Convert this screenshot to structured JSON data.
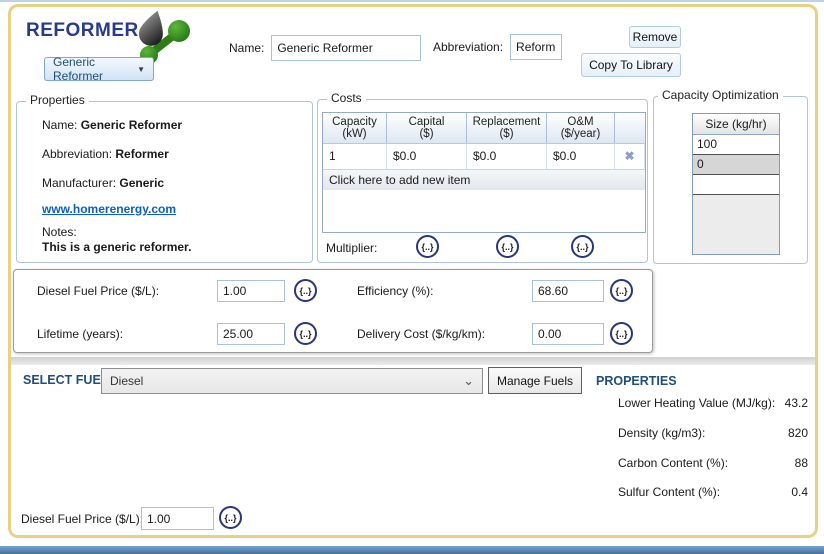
{
  "colors": {
    "title_blue": "#273b8e",
    "accent_blue": "#1f4e79",
    "gold_border": "#e8d185",
    "bottom_bar_blue": "#44719f",
    "link_blue": "#0b5fc0",
    "icon_green": "#2f7d17"
  },
  "icons": {
    "reformer": "oil-drop-and-molecule",
    "selector_arrow": "▼",
    "delete": "✖",
    "fuel_dropdown_chevron": "⌄"
  },
  "header": {
    "title": "REFORMER",
    "selector_value": "Generic Reformer",
    "name_label": "Name:",
    "name_value": "Generic Reformer",
    "abbreviation_label": "Abbreviation:",
    "abbreviation_value": "Reformer",
    "remove_button": "Remove",
    "copy_button": "Copy To Library"
  },
  "properties_box": {
    "title": "Properties",
    "rows": [
      {
        "label": "Name:",
        "value": "Generic Reformer"
      },
      {
        "label": "Abbreviation:",
        "value": "Reformer"
      },
      {
        "label": "Manufacturer:",
        "value": "Generic"
      }
    ],
    "link": "www.homerenergy.com",
    "notes_label": "Notes:",
    "notes_value": "This is a generic reformer."
  },
  "costs_box": {
    "title": "Costs",
    "table": {
      "headers": [
        {
          "line1": "Capacity",
          "line2": "(kW)"
        },
        {
          "line1": "Capital",
          "line2": "($)"
        },
        {
          "line1": "Replacement",
          "line2": "($)"
        },
        {
          "line1": "O&M",
          "line2": "($/year)"
        }
      ],
      "rows": [
        [
          "1",
          "$0.0",
          "$0.0",
          "$0.0"
        ]
      ],
      "add_row_text": "Click here to add new item"
    },
    "multiplier_label": "Multiplier:",
    "dots_glyph": "{..}"
  },
  "capacity_box": {
    "title": "Capacity Optimization",
    "header": "Size (kg/hr)",
    "rows": [
      "100",
      "0",
      ""
    ]
  },
  "params_box": {
    "left": [
      {
        "label": "Diesel Fuel Price ($/L):",
        "value": "1.00"
      },
      {
        "label": "Lifetime (years):",
        "value": "25.00"
      }
    ],
    "right": [
      {
        "label": "Efficiency (%):",
        "value": "68.60"
      },
      {
        "label": "Delivery Cost ($/kg/km):",
        "value": "0.00"
      }
    ],
    "dots_glyph": "{..}"
  },
  "fuel_section": {
    "select_label": "SELECT FUEL:",
    "selected_fuel": "Diesel",
    "manage_button": "Manage Fuels",
    "properties_title": "PROPERTIES",
    "properties": [
      {
        "label": "Lower Heating Value (MJ/kg):",
        "value": "43.2"
      },
      {
        "label": "Density (kg/m3):",
        "value": "820"
      },
      {
        "label": "Carbon Content (%):",
        "value": "88"
      },
      {
        "label": "Sulfur Content (%):",
        "value": "0.4"
      }
    ],
    "price_label": "Diesel Fuel Price ($/L):",
    "price_value": "1.00",
    "dots_glyph": "{..}"
  }
}
